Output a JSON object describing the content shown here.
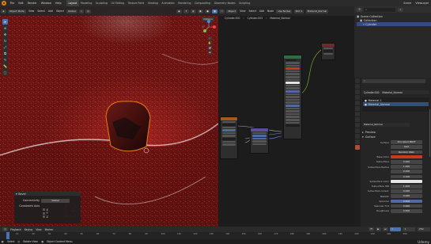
{
  "menu": [
    "File",
    "Edit",
    "Render",
    "Window",
    "Help"
  ],
  "workspaces": [
    "Layout",
    "Modeling",
    "Sculpting",
    "UV Editing",
    "Texture Paint",
    "Shading",
    "Animation",
    "Rendering",
    "Compositing",
    "Geometry Nodes",
    "Scripting"
  ],
  "active_workspace": "Layout",
  "scene": {
    "name": "Scene",
    "view_layer": "ViewLayer"
  },
  "viewport": {
    "mode": "Object Mode",
    "menus": [
      "View",
      "Select",
      "Add",
      "Object"
    ],
    "transform": "Global",
    "options": "Options"
  },
  "operator_panel": {
    "title": "Bevel",
    "rows": [
      {
        "label": "Connectivity",
        "value": "Global"
      },
      {
        "label": "Constraint Axis",
        "value": ""
      }
    ],
    "axes": [
      "X",
      "Y",
      "Z"
    ]
  },
  "node_editor": {
    "mode": "Object",
    "menus": [
      "View",
      "Select",
      "Add",
      "Node"
    ],
    "use_nodes": "Use Nodes",
    "slot": "Slot 1",
    "material": "Material_Normal",
    "breadcrumb": [
      "Cylinder.000",
      "Cylinder.003",
      "Material_Normal"
    ]
  },
  "outliner": {
    "items": [
      {
        "label": "Scene Collection"
      },
      {
        "label": "Collection"
      },
      {
        "label": "Cylinder"
      }
    ]
  },
  "properties": {
    "object": "Cylinder.000",
    "material_tab": "Material_Normal",
    "slots": [
      "Material.1",
      "Material_Normal"
    ],
    "material_name": "Material_Normal",
    "preview_label": "Preview",
    "surface_label": "Surface",
    "surface_value": "Principled BSDF",
    "distribution": "GGX",
    "subsurface_method": "Random Walk",
    "fields": [
      {
        "label": "Base Color",
        "value": "",
        "style": "red"
      },
      {
        "label": "Subsurface",
        "value": "0.000"
      },
      {
        "label": "Subsurface Radius",
        "value": "1.000"
      },
      {
        "label": "",
        "value": "0.200"
      },
      {
        "label": "",
        "value": "0.100"
      },
      {
        "label": "Subsurface Color",
        "value": "",
        "style": "white"
      },
      {
        "label": "Subsurface IOR",
        "value": "1.400"
      },
      {
        "label": "Subsurface Anisot.",
        "value": "0.000"
      },
      {
        "label": "Metallic",
        "value": "0.000"
      },
      {
        "label": "Specular",
        "value": "0.500",
        "style": "blue"
      },
      {
        "label": "Specular Tint",
        "value": "0.000"
      },
      {
        "label": "Roughness",
        "value": "0.500"
      }
    ]
  },
  "timeline": {
    "menus": [
      "Playback",
      "Keying",
      "View",
      "Marker"
    ],
    "frames": [
      "10",
      "20",
      "30",
      "40",
      "50",
      "60",
      "70",
      "80",
      "90",
      "100",
      "110",
      "120",
      "130",
      "140",
      "150",
      "160",
      "170",
      "180",
      "190",
      "200",
      "210",
      "220",
      "230",
      "240",
      "250"
    ],
    "current_frame": "1",
    "start": "1",
    "end": "250"
  },
  "statusbar": {
    "left": "Select",
    "middle": "Rotate View",
    "right": "Object Context Menu",
    "watermark": "Udemy"
  },
  "colors": {
    "accent": "#4772b3",
    "selection": "#e87d0d",
    "base_color": "#c73a1f",
    "car_paint": "#8e1a17"
  }
}
